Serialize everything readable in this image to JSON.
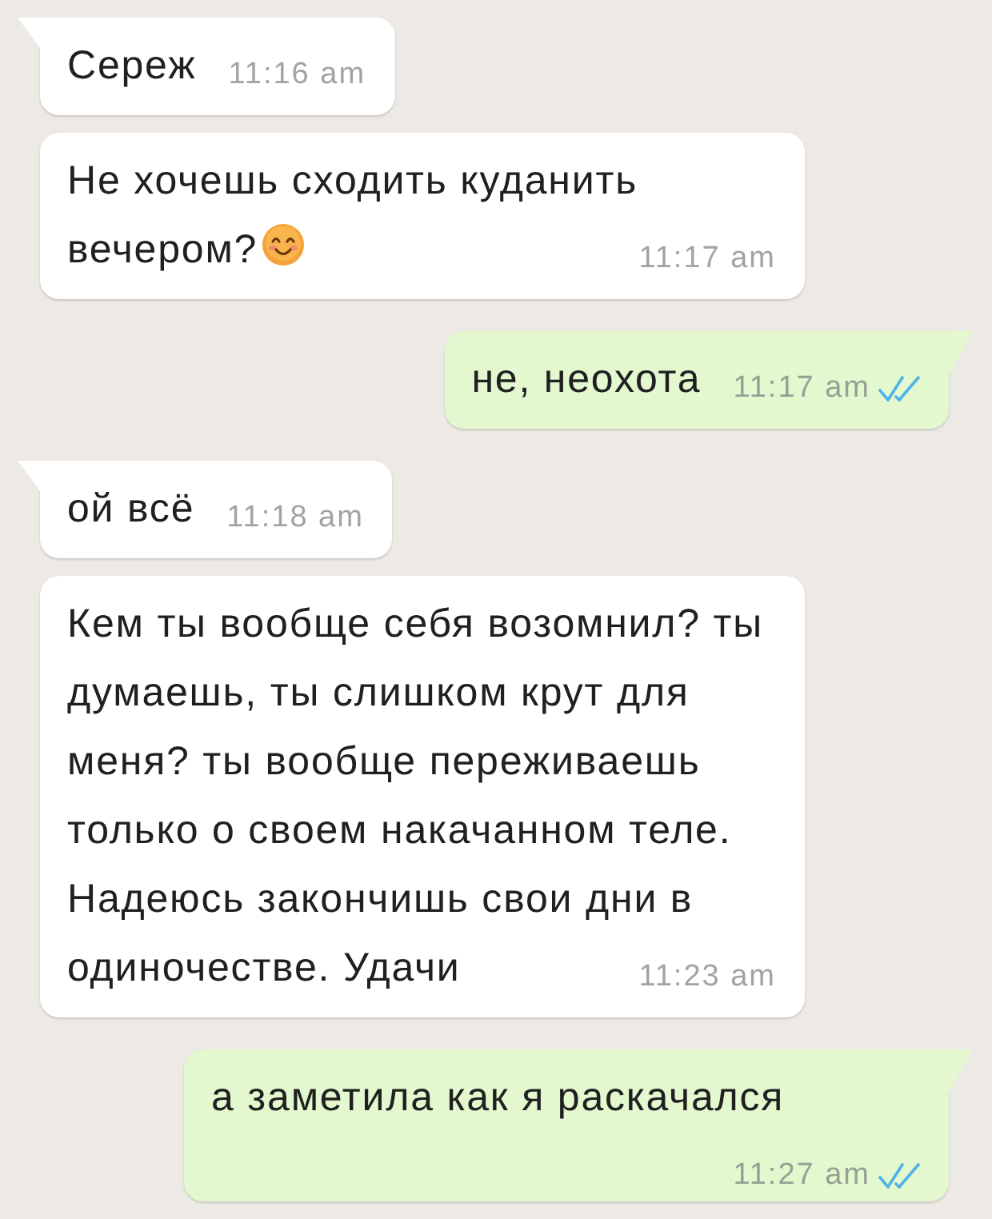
{
  "messages": [
    {
      "kind": "incoming",
      "tail": true,
      "lines": [
        "Сереж"
      ],
      "time": "11:16 am"
    },
    {
      "kind": "incoming",
      "tail": false,
      "lines": [
        "Не хочешь сходить куданить",
        "вечером?"
      ],
      "emoji": true,
      "time": "11:17 am"
    },
    {
      "kind": "outgoing",
      "tail": true,
      "lines": [
        "не, неохота"
      ],
      "time": "11:17 am",
      "read": true
    },
    {
      "kind": "incoming",
      "tail": true,
      "lines": [
        "ой всё"
      ],
      "time": "11:18 am"
    },
    {
      "kind": "incoming",
      "tail": false,
      "lines": [
        "Кем ты вообще себя возомнил? ты",
        "думаешь, ты слишком крут для",
        "меня? ты вообще переживаешь",
        "только о своем накачанном теле.",
        "Надеюсь закончишь свои дни в",
        "одиночестве. Удачи"
      ],
      "time": "11:23 am"
    },
    {
      "kind": "outgoing",
      "tail": true,
      "lines": [
        "а заметила как я раскачался"
      ],
      "time": "11:27 am",
      "read": true
    }
  ]
}
